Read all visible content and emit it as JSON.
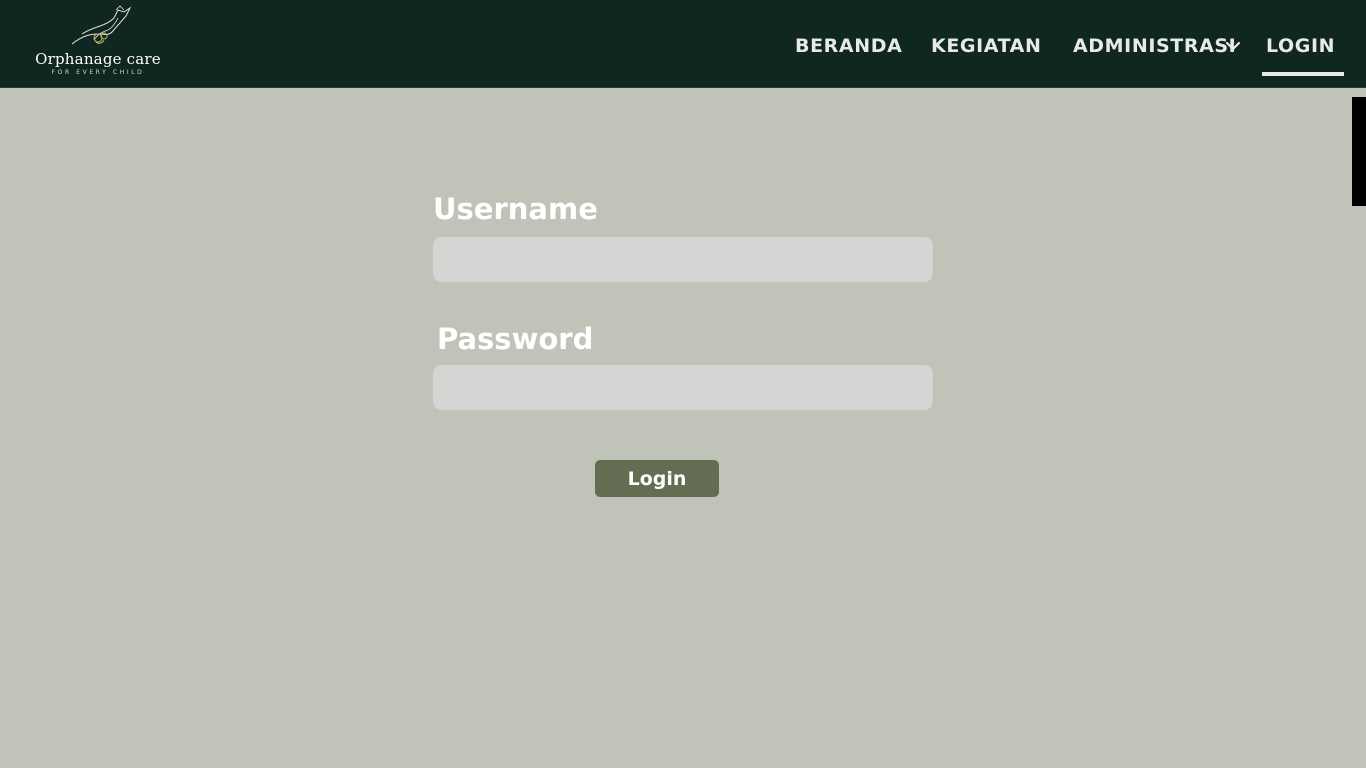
{
  "header": {
    "logo": {
      "name": "Orphanage care",
      "tagline": "FOR EVERY CHILD",
      "icon": "hands-icon"
    },
    "nav": {
      "beranda": "BERANDA",
      "kegiatan": "KEGIATAN",
      "administrasi": "ADMINISTRASI",
      "login": "LOGIN",
      "active": "LOGIN"
    }
  },
  "form": {
    "username_label": "Username",
    "username_value": "",
    "password_label": "Password",
    "password_value": "",
    "submit_label": "Login"
  },
  "colors": {
    "navbar": "#0f2621",
    "page_background": "#c0c3b8",
    "input_background": "#d5d5d4",
    "button": "#646d52",
    "logo_accent": "#c9b45a"
  }
}
